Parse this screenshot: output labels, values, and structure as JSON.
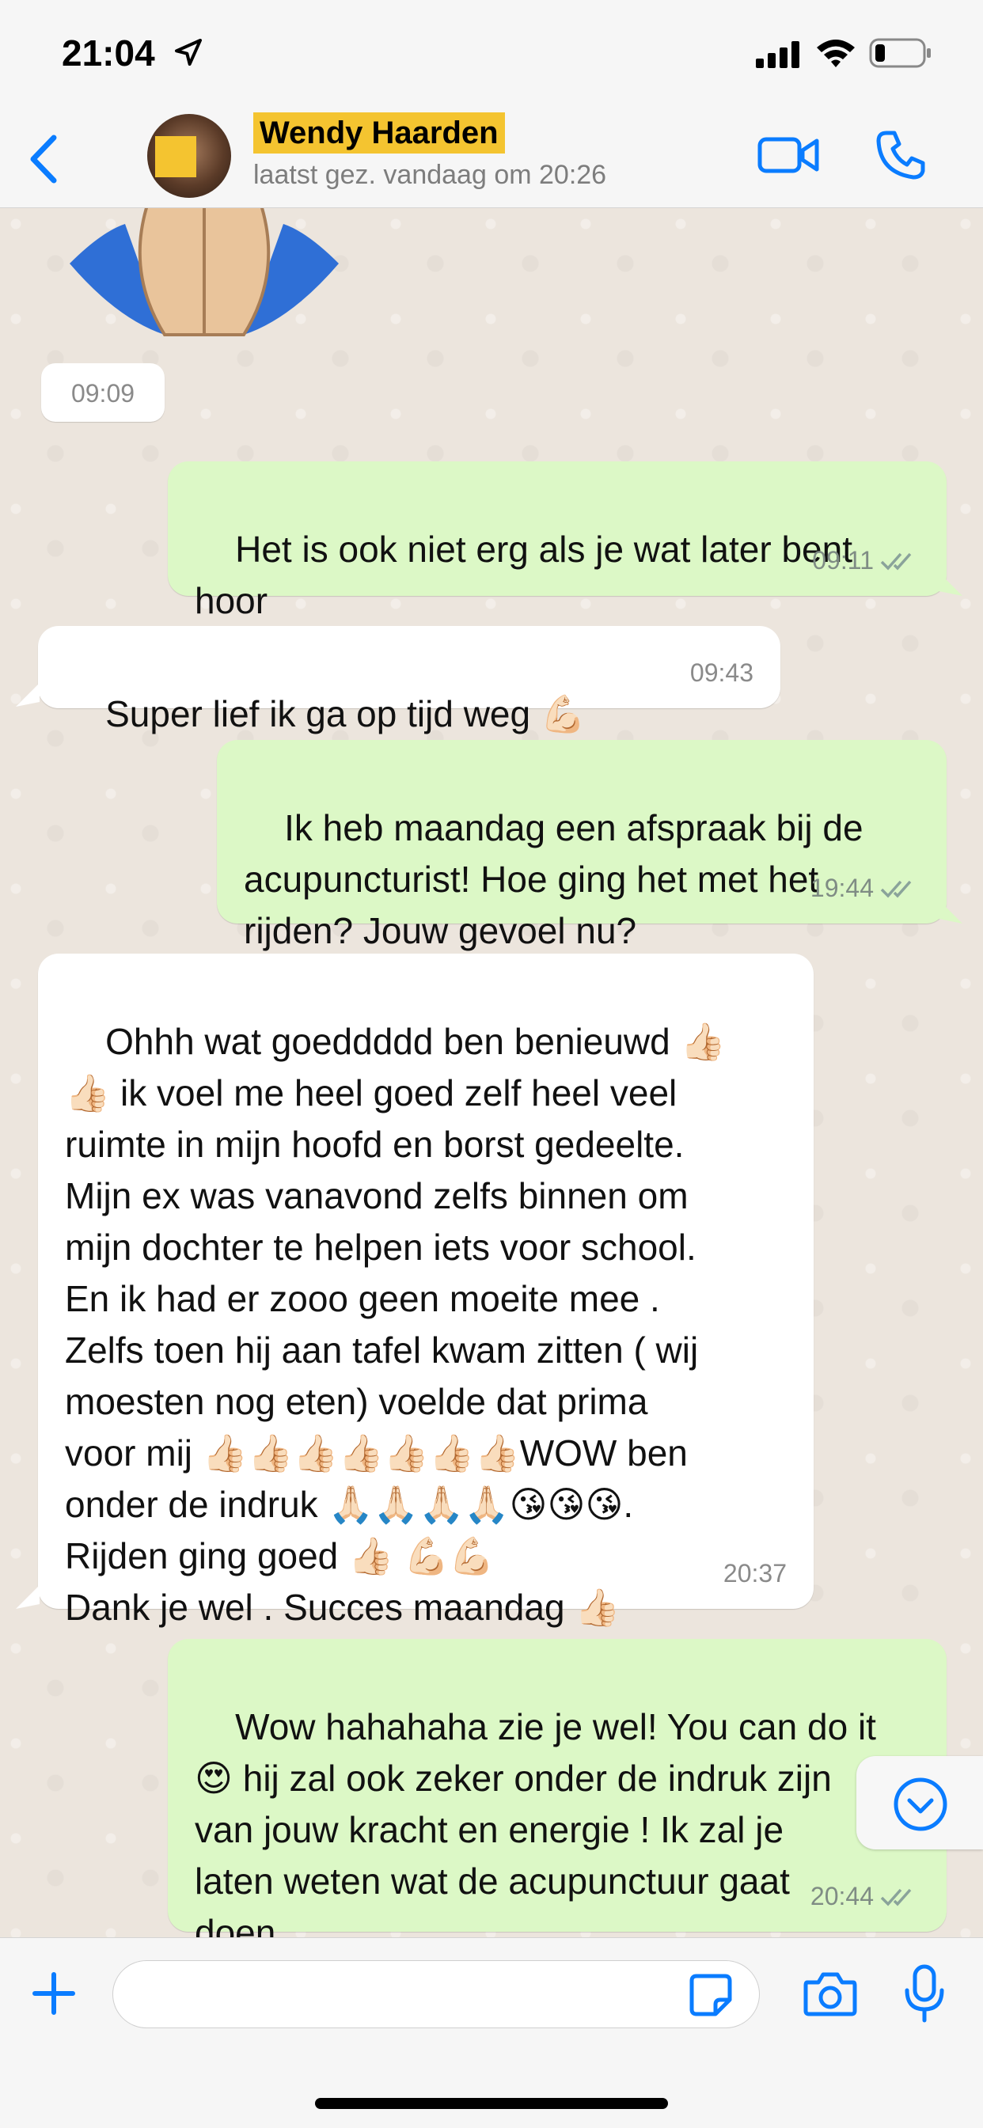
{
  "status_bar": {
    "time": "21:04"
  },
  "header": {
    "contact_name": "Wendy Haarden",
    "last_seen": "laatst gez. vandaag om 20:26"
  },
  "chat": {
    "sticker_time": "09:09",
    "messages": [
      {
        "direction": "out",
        "text": "Het is ook niet erg als je wat later bent\nhoor",
        "time": "09:11",
        "read": true
      },
      {
        "direction": "in",
        "text": "Super lief ik ga op tijd weg 💪🏻",
        "time": "09:43"
      },
      {
        "direction": "out",
        "text": "Ik heb maandag een afspraak bij de\nacupuncturist! Hoe ging het met het\nrijden? Jouw gevoel nu?",
        "time": "19:44",
        "read": true
      },
      {
        "direction": "in",
        "text": "Ohhh wat goeddddd ben benieuwd 👍🏻\n👍🏻 ik voel me heel goed zelf heel veel\nruimte in mijn hoofd en borst gedeelte.\nMijn ex was vanavond zelfs binnen om\nmijn dochter te helpen iets voor school.\nEn ik had er zooo geen moeite mee .\nZelfs toen hij aan tafel kwam zitten ( wij\nmoesten nog eten) voelde dat prima\nvoor mij 👍🏻👍🏻👍🏻👍🏻👍🏻👍🏻👍🏻WOW ben\nonder de indruk 🙏🏻🙏🏻🙏🏻🙏🏻😘😘😘.\nRijden ging goed 👍🏻 💪🏻💪🏻\nDank je wel . Succes maandag 👍🏻",
        "time": "20:37"
      },
      {
        "direction": "out",
        "text": "Wow hahahaha zie je wel! You can do it\n😍 hij zal ook zeker onder de indruk zijn\nvan jouw kracht en energie ! Ik zal je\nlaten weten wat de acupunctuur gaat\ndoen",
        "time": "20:44",
        "read": true
      }
    ]
  },
  "input": {
    "placeholder": ""
  },
  "colors": {
    "accent": "#0a7cff",
    "outgoing_bubble": "#dcf8c6",
    "incoming_bubble": "#ffffff",
    "read_ticks": "#8aa39a"
  },
  "icons": [
    "location-arrow-icon",
    "signal-icon",
    "wifi-icon",
    "battery-icon",
    "back-chevron-icon",
    "video-call-icon",
    "phone-icon",
    "read-ticks-icon",
    "scroll-down-icon",
    "plus-icon",
    "sticker-icon",
    "camera-icon",
    "microphone-icon"
  ]
}
